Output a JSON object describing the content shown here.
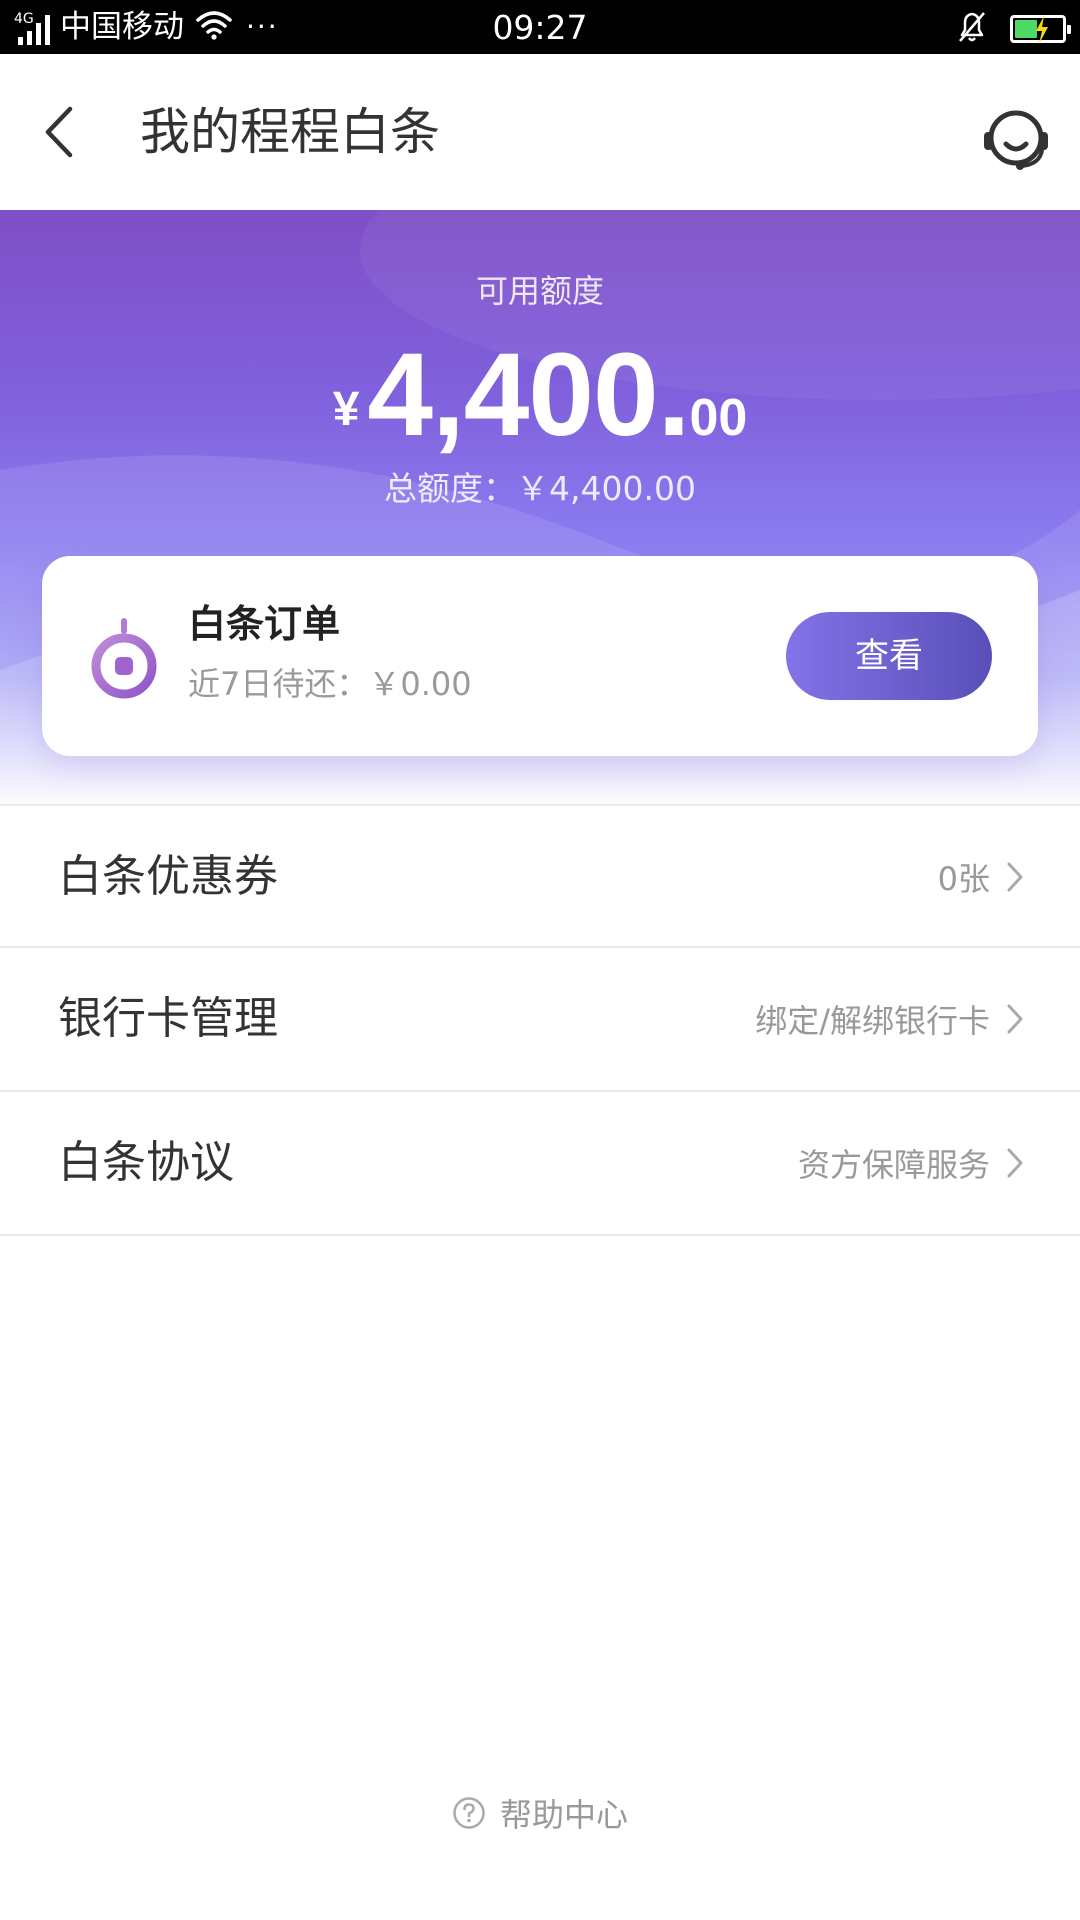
{
  "status_bar": {
    "network": "4G",
    "carrier": "中国移动",
    "more": "···",
    "time": "09:27"
  },
  "nav": {
    "title": "我的程程白条"
  },
  "credit": {
    "available_label": "可用额度",
    "currency_symbol": "¥",
    "amount_integer": "4,400.",
    "amount_decimal": "00",
    "total_text": "总额度：￥4,400.00"
  },
  "order_card": {
    "title": "白条订单",
    "subtitle": "近7日待还：￥0.00",
    "button_label": "查看"
  },
  "list": {
    "items": [
      {
        "label": "白条优惠券",
        "value": "0张"
      },
      {
        "label": "银行卡管理",
        "value": "绑定/解绑银行卡"
      },
      {
        "label": "白条协议",
        "value": "资方保障服务"
      }
    ]
  },
  "footer": {
    "help_label": "帮助中心"
  },
  "colors": {
    "accent": "#7b5fd9",
    "button_start": "#8273e8",
    "button_end": "#5a4fb8",
    "battery": "#4cd964"
  }
}
